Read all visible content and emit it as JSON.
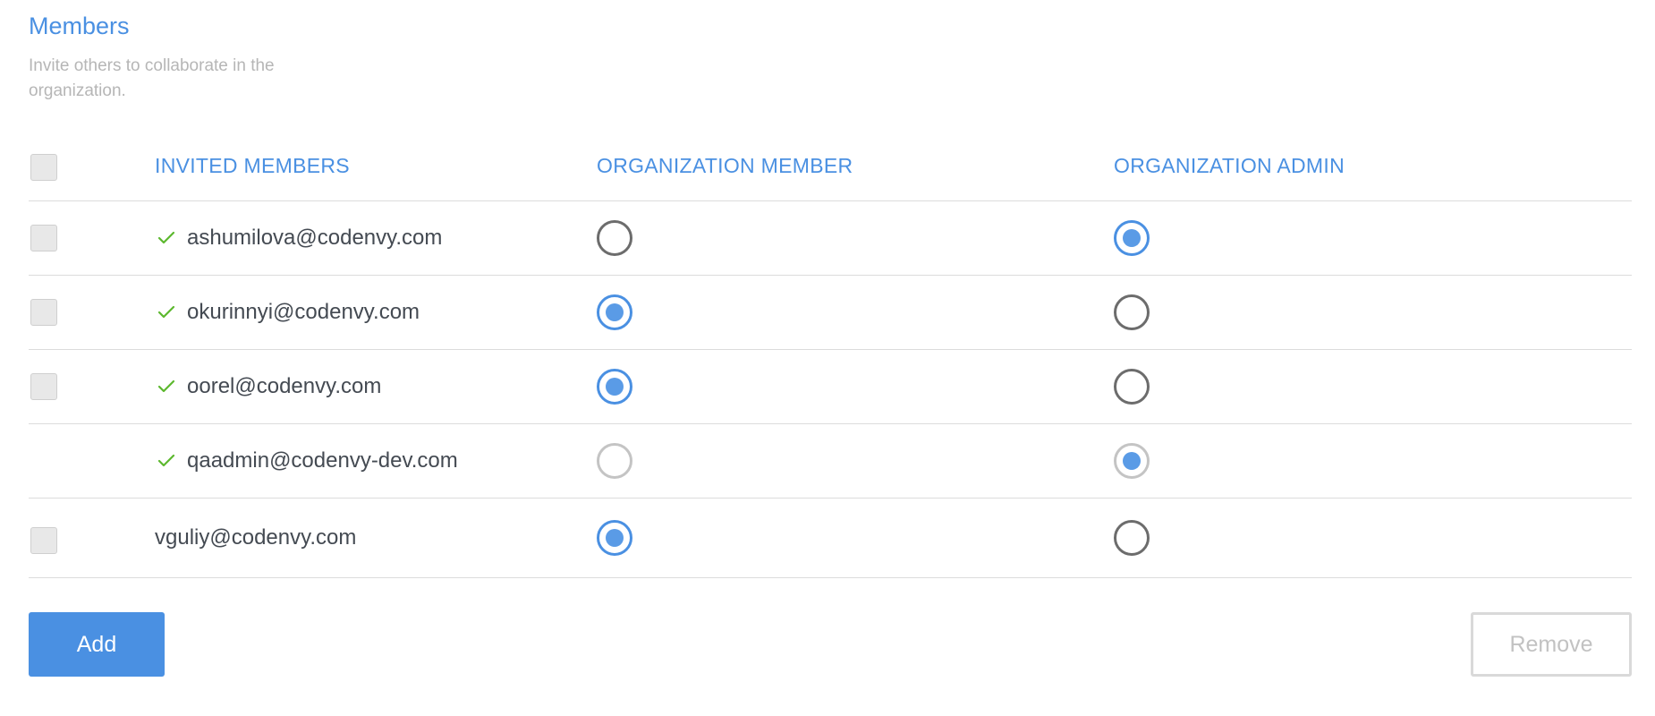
{
  "section": {
    "title": "Members",
    "subtitle": "Invite others to collaborate in the organization."
  },
  "table": {
    "headers": {
      "invited_members": "INVITED MEMBERS",
      "organization_member": "ORGANIZATION MEMBER",
      "organization_admin": "ORGANIZATION ADMIN"
    },
    "rows": [
      {
        "email": "ashumilova@codenvy.com",
        "accepted": true,
        "role": "admin",
        "selectable": true
      },
      {
        "email": "okurinnyi@codenvy.com",
        "accepted": true,
        "role": "member",
        "selectable": true
      },
      {
        "email": "oorel@codenvy.com",
        "accepted": true,
        "role": "member",
        "selectable": true
      },
      {
        "email": "qaadmin@codenvy-dev.com",
        "accepted": true,
        "role": "admin",
        "selectable": false
      },
      {
        "email": "vguliy@codenvy.com",
        "accepted": false,
        "role": "member",
        "selectable": true
      }
    ]
  },
  "buttons": {
    "add_label": "Add",
    "remove_label": "Remove"
  },
  "icons": {
    "accepted": "check-icon"
  },
  "colors": {
    "accent": "#4a90e2",
    "accepted_check": "#5cb82e",
    "muted_text": "#b6b6b6"
  }
}
